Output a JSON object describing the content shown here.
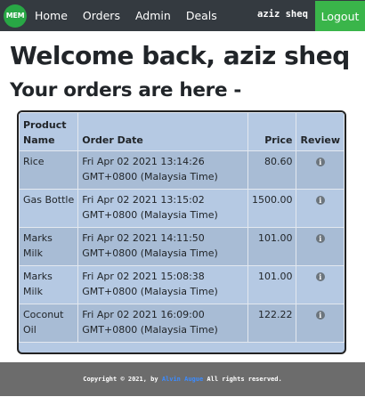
{
  "nav": {
    "logo_text": "MEM",
    "links": [
      "Home",
      "Orders",
      "Admin",
      "Deals"
    ],
    "user": "aziz sheq",
    "logout_label": "Logout"
  },
  "welcome": "Welcome back, aziz sheq",
  "subtitle": "Your orders are here -",
  "table": {
    "headers": [
      "Product Name",
      "Order Date",
      "Price",
      "Review"
    ],
    "rows": [
      {
        "name": "Rice",
        "date": "Fri Apr 02 2021 13:14:26 GMT+0800 (Malaysia Time)",
        "price": "80.60"
      },
      {
        "name": "Gas Bottle",
        "date": "Fri Apr 02 2021 13:15:02 GMT+0800 (Malaysia Time)",
        "price": "1500.00"
      },
      {
        "name": "Marks Milk",
        "date": "Fri Apr 02 2021 14:11:50 GMT+0800 (Malaysia Time)",
        "price": "101.00"
      },
      {
        "name": "Marks Milk",
        "date": "Fri Apr 02 2021 15:08:38 GMT+0800 (Malaysia Time)",
        "price": "101.00"
      },
      {
        "name": "Coconut Oil",
        "date": "Fri Apr 02 2021 16:09:00 GMT+0800 (Malaysia Time)",
        "price": "122.22"
      }
    ],
    "review_icon": "info-icon"
  },
  "footer": {
    "prefix": "Copyright © 2021, by",
    "author": "Alvin Augue",
    "suffix": "All rights reserved."
  },
  "colors": {
    "navbar": "#343a40",
    "logout": "#3ab54a",
    "table_bg": "#b5c9e3",
    "footer": "#6c6c6c"
  }
}
